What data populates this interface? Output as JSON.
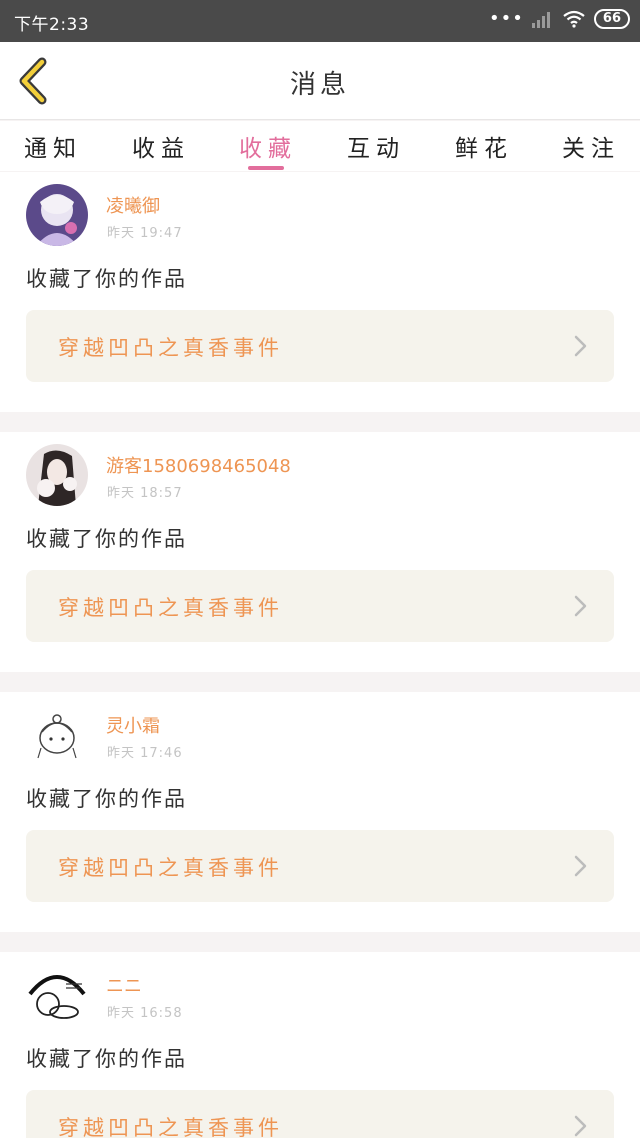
{
  "status_bar": {
    "time": "下午2:33",
    "signal_dots": "•••",
    "battery": "66"
  },
  "header": {
    "title": "消息",
    "back_icon": "chevron-left-icon"
  },
  "tabs": [
    {
      "label": "通知"
    },
    {
      "label": "收益"
    },
    {
      "label": "收藏",
      "active": true
    },
    {
      "label": "互动"
    },
    {
      "label": "鲜花"
    },
    {
      "label": "关注"
    }
  ],
  "colors": {
    "accent_pink": "#e26e9c",
    "accent_orange": "#ee9553",
    "card_bg": "#f5f3ec"
  },
  "notifications": [
    {
      "user": "凌曦御",
      "time": "昨天 19:47",
      "message": "收藏了你的作品",
      "work_title": "穿越凹凸之真香事件"
    },
    {
      "user": "游客1580698465048",
      "time": "昨天 18:57",
      "message": "收藏了你的作品",
      "work_title": "穿越凹凸之真香事件"
    },
    {
      "user": "灵小霜",
      "time": "昨天 17:46",
      "message": "收藏了你的作品",
      "work_title": "穿越凹凸之真香事件"
    },
    {
      "user": "ニニ",
      "time": "昨天 16:58",
      "message": "收藏了你的作品",
      "work_title": "穿越凹凸之真香事件"
    }
  ]
}
